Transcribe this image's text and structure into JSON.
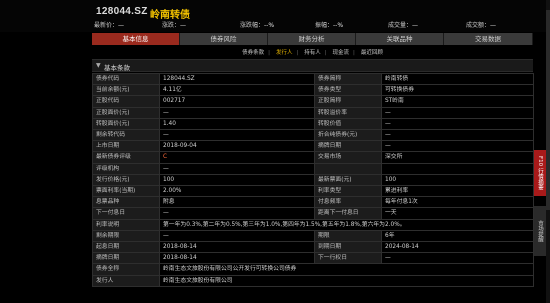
{
  "header": {
    "code": "128044.SZ",
    "name": "岭南转债"
  },
  "stats": [
    {
      "label": "最新价：",
      "value": "—"
    },
    {
      "label": "涨跌：",
      "value": "—"
    },
    {
      "label": "涨跌幅：",
      "value": "--%"
    },
    {
      "label": "振幅：",
      "value": "--%"
    },
    {
      "label": "成交量：",
      "value": "—"
    },
    {
      "label": "成交额：",
      "value": "—"
    }
  ],
  "tabs": [
    "基本信息",
    "债券风险",
    "财务分析",
    "关联品种",
    "交易数据"
  ],
  "subtabs": [
    "债券条款",
    "发行人",
    "持有人",
    "现金流",
    "最近回顾"
  ],
  "section": {
    "title": "基本条款"
  },
  "rows": [
    [
      "债券代码",
      "128044.SZ",
      "债券简称",
      "岭南转债"
    ],
    [
      "当前余额(元)",
      "4.11亿",
      "债券类型",
      "可转换债券"
    ],
    [
      "正股代码",
      "002717",
      "正股简称",
      "ST岭南"
    ],
    [
      "正股面价(元)",
      "—",
      "转股溢价率",
      "—"
    ],
    [
      "转股面价(元)",
      "1.40",
      "转股价值",
      "—"
    ],
    [
      "剩余转代码",
      "—",
      "折合纯债券(元)",
      "—"
    ],
    [
      "上市日期",
      "2018-09-04",
      "摘牌日期",
      "—"
    ],
    [
      "最新债券评级",
      "C",
      "交易市场",
      "深交所"
    ],
    [
      "评级机构",
      "—",
      "",
      ""
    ],
    [
      "发行价格(元)",
      "100",
      "最新票面(元)",
      "100"
    ],
    [
      "票面利率(当期)",
      "2.00%",
      "利率类型",
      "累进利率"
    ],
    [
      "息票品种",
      "附息",
      "付息频率",
      "每年付息1次"
    ],
    [
      "下一付息日",
      "—",
      "距离下一付息日",
      "一天"
    ],
    [
      "利率说明",
      "第一年为0.3%,第二年为0.5%,第三年为1.0%,第四年为1.5%,第五年为1.8%,第六年为2.0%。"
    ],
    [
      "剩余期限",
      "—",
      "期限",
      "6年"
    ],
    [
      "起息日期",
      "2018-08-14",
      "到期日期",
      "2024-08-14"
    ],
    [
      "摘牌日期",
      "2018-08-14",
      "下一行权日",
      "—"
    ],
    [
      "债券全称",
      "岭南生态文旅股份有限公司公开发行可转换公司债券"
    ],
    [
      "发行人",
      "岭南生态文旅股份有限公司"
    ]
  ],
  "sidebar": {
    "red": "F10 行情摘要",
    "dark": "市场提醒"
  },
  "colors": {
    "accent": "#9a2a1e",
    "name": "#f0c000",
    "active_subtab": "#e6b400"
  }
}
